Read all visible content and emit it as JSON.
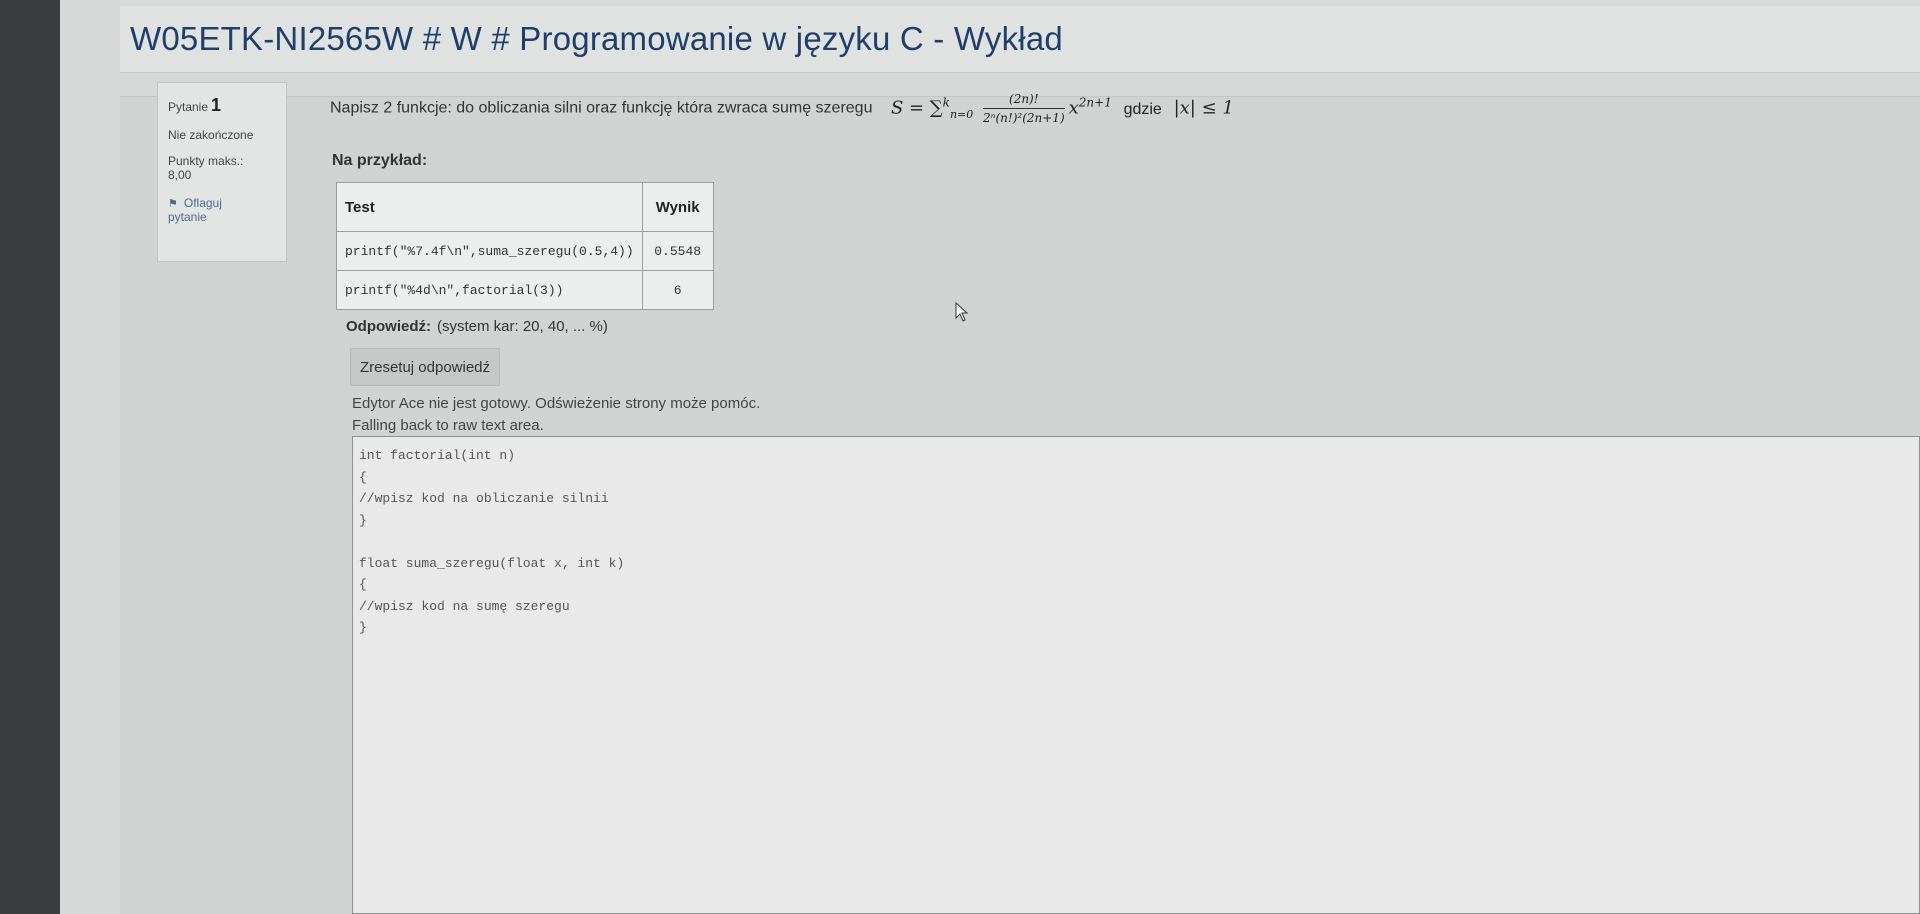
{
  "course": {
    "title": "W05ETK-NI2565W # W # Programowanie w języku C - Wykład"
  },
  "question_info": {
    "label": "Pytanie",
    "number": "1",
    "status": "Nie zakończone",
    "points_label": "Punkty maks.:",
    "points_value": "8,00",
    "flag_label": "Oflaguj",
    "flag_label_2": "pytanie"
  },
  "question": {
    "text": "Napisz 2 funkcje: do obliczania silni oraz funkcję która zwraca sumę szeregu",
    "formula_lhs": "S = ∑",
    "sum_upper": "k",
    "sum_lower": "n=0",
    "frac_num": "(2n)!",
    "frac_den": "2ⁿ(n!)²(2n+1)",
    "power_base": "x",
    "power_exp": "2n+1",
    "gdzie": "gdzie",
    "condition": "|x| ≤ 1"
  },
  "example": {
    "label": "Na przykład:",
    "headers": [
      "Test",
      "Wynik"
    ],
    "rows": [
      {
        "test": "printf(\"%7.4f\\n\",suma_szeregu(0.5,4))",
        "result": "0.5548"
      },
      {
        "test": "printf(\"%4d\\n\",factorial(3))",
        "result": "6"
      }
    ]
  },
  "answer": {
    "label": "Odpowiedź:",
    "hint": "(system kar: 20, 40, ... %)",
    "reset_button": "Zresetuj odpowiedź",
    "notice_ace": "Edytor Ace nie jest gotowy. Odświeżenie strony może pomóc.",
    "notice_fallback": "Falling back to raw text area.",
    "code": "int factorial(int n)\n{\n//wpisz kod na obliczanie silnii\n}\n\nfloat suma_szeregu(float x, int k)\n{\n//wpisz kod na sumę szeregu\n}"
  },
  "colors": {
    "title": "#1f3f6b",
    "background": "#d6d9d8",
    "button": "#c4c8c7"
  }
}
